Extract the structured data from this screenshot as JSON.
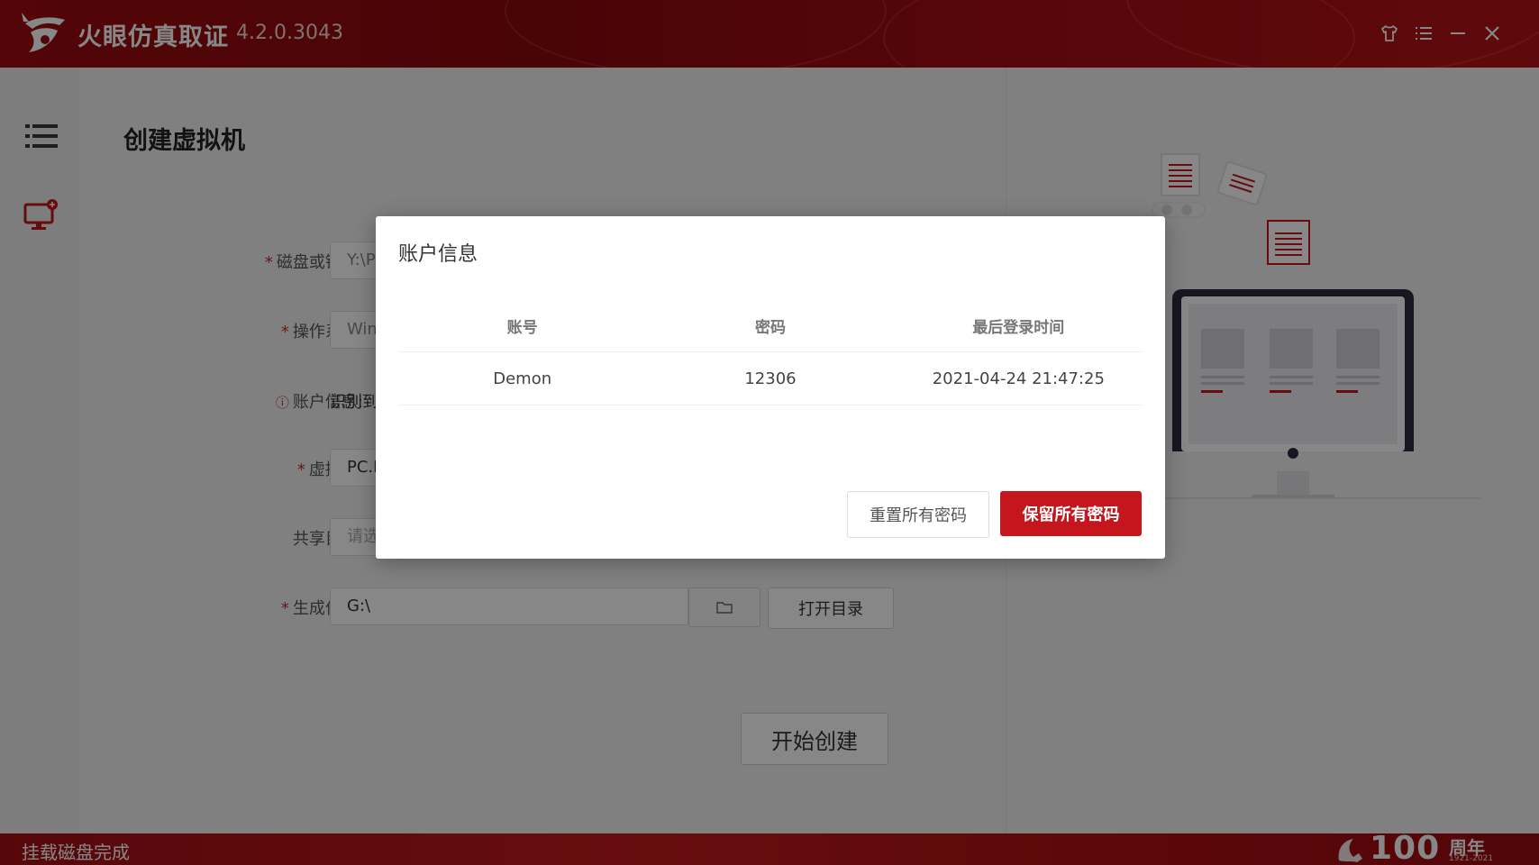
{
  "app": {
    "name": "火眼仿真取证",
    "version": "4.2.0.3043"
  },
  "page": {
    "title": "创建虚拟机"
  },
  "form": {
    "disk": {
      "label": "磁盘或镜像:",
      "value": "Y:\\P"
    },
    "os": {
      "label": "操作系统:",
      "value": "Win"
    },
    "account": {
      "label": "账户信息:",
      "value": "识别到"
    },
    "vm": {
      "label": "虚拟机:",
      "value": "PC.I"
    },
    "share": {
      "label": "共享目录:",
      "placeholder": "请选"
    },
    "output": {
      "label": "生成位置:",
      "value": "G:\\"
    },
    "open_dir_label": "打开目录",
    "start_label": "开始创建"
  },
  "status": {
    "text": "挂载磁盘完成"
  },
  "modal": {
    "title": "账户信息",
    "columns": [
      "账号",
      "密码",
      "最后登录时间"
    ],
    "rows": [
      {
        "account": "Demon",
        "password": "12306",
        "last_login": "2021-04-24 21:47:25"
      }
    ],
    "reset_label": "重置所有密码",
    "keep_label": "保留所有密码"
  },
  "anniversary": {
    "number": "100",
    "label": "周年",
    "years": "1921-2021"
  },
  "colors": {
    "brand_red": "#c4161c",
    "title_red": "#9e0b10"
  }
}
